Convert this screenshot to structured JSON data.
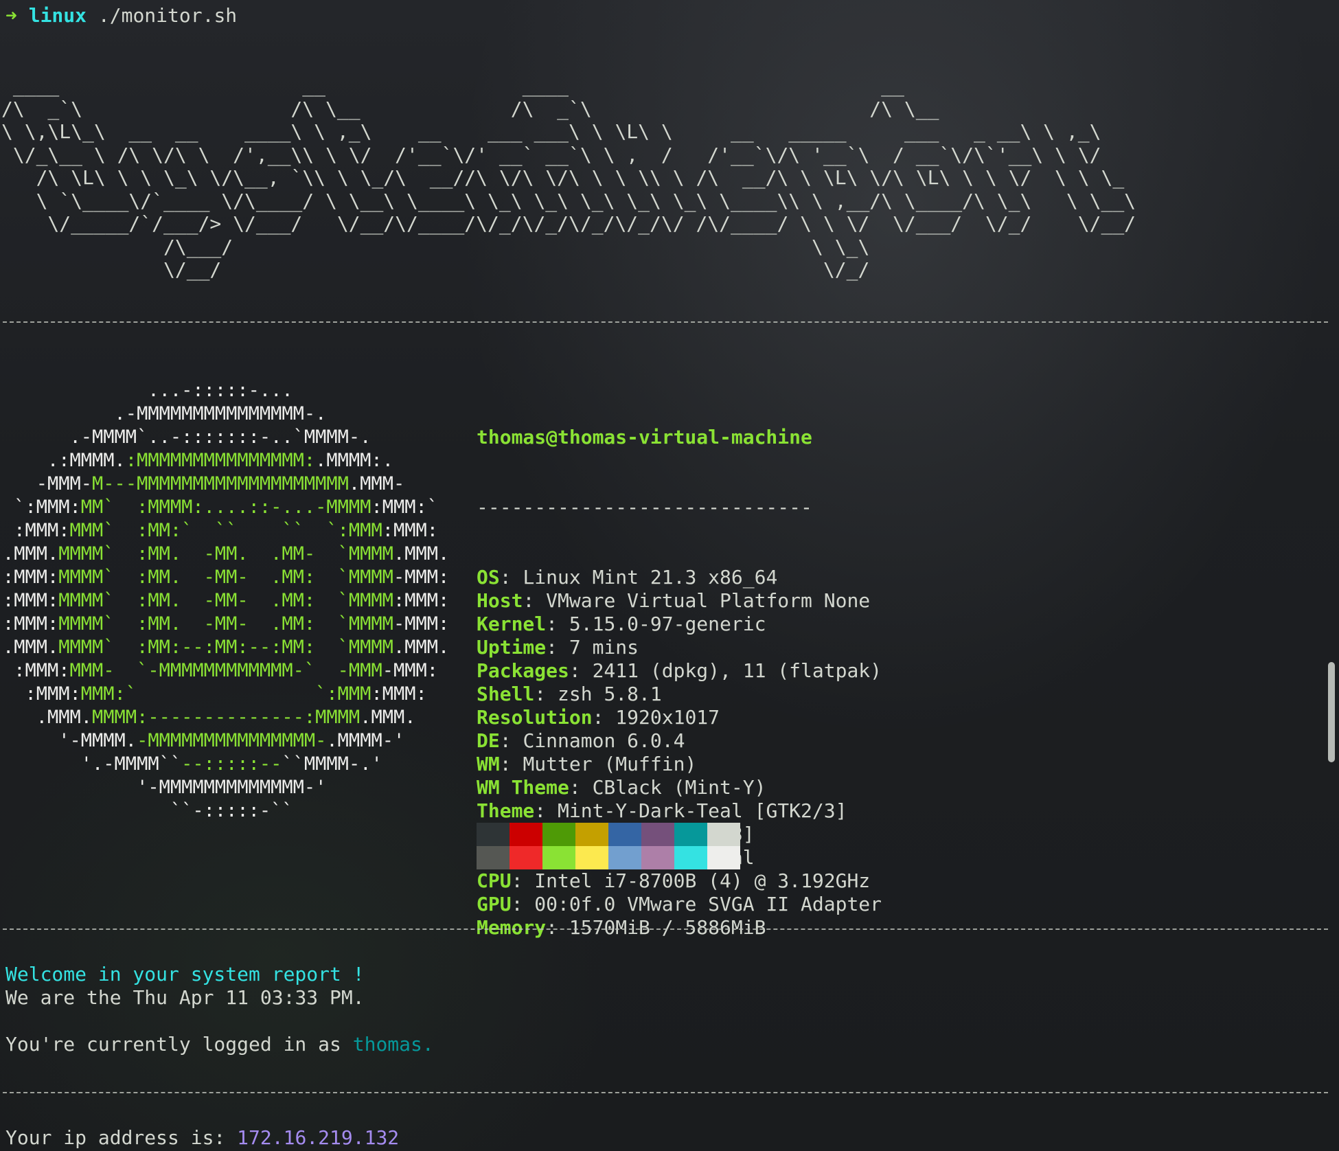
{
  "prompt": {
    "arrow": "➜",
    "dir": "linux",
    "command": "./monitor.sh"
  },
  "banner": {
    "lines": [
      " ____                     __                 ____                           __",
      "/\\  _`\\                  /\\ \\__             /\\  _`\\                        /\\ \\__",
      "\\ \\,\\L\\_\\  __  __    ____\\ \\ ,_\\    __    ___ ___\\ \\ \\L\\ \\     __   _____     ___   _ __\\ \\ ,_\\",
      " \\/_\\__ \\ /\\ \\/\\ \\  /',__\\\\ \\ \\/  /'__`\\/' __` __`\\ \\ ,  /   /'__`\\/\\ '__`\\  / __`\\/\\`'__\\ \\ \\/",
      "   /\\ \\L\\ \\ \\ \\_\\ \\/\\__, `\\\\ \\ \\_/\\  __//\\ \\/\\ \\/\\ \\ \\ \\\\ \\ /\\  __/\\ \\ \\L\\ \\/\\ \\L\\ \\ \\ \\/  \\ \\ \\_",
      "   \\ `\\____\\/`____ \\/\\____/ \\ \\__\\ \\____\\ \\_\\ \\_\\ \\_\\ \\_\\ \\_\\ \\____\\\\ \\ ,__/\\ \\____/\\ \\_\\   \\ \\__\\",
      "    \\/_____/`/___/> \\/___/   \\/__/\\/____/\\/_/\\/_/\\/_/\\/_/\\/ /\\/____/ \\ \\ \\/  \\/___/  \\/_/    \\/__/",
      "              /\\___/                                                  \\ \\_\\",
      "              \\/__/                                                    \\/_/"
    ]
  },
  "logo": {
    "lines": [
      [
        [
          "             ...-:::::-...",
          ""
        ]
      ],
      [
        [
          "          .-MMMMMMMMMMMMMMM-.",
          ""
        ]
      ],
      [
        [
          "      .-MMMM`..-:::::::-..`MMMM-.",
          ""
        ]
      ],
      [
        [
          "    .:MMMM.",
          ""
        ],
        [
          ":MMMMMMMMMMMMMMM:",
          "g"
        ],
        [
          ".MMMM:.",
          ""
        ]
      ],
      [
        [
          "   -MMM-",
          ""
        ],
        [
          "M---MMMMMMMMMMMMMMMMMMM",
          "g"
        ],
        [
          ".MMM-",
          ""
        ]
      ],
      [
        [
          " `:MMM:",
          ""
        ],
        [
          "MM`  :MMMM:....::-...-MMMM",
          "g"
        ],
        [
          ":MMM:`",
          ""
        ]
      ],
      [
        [
          " :MMM:",
          ""
        ],
        [
          "MMM`  :MM:`  ``    ``  `:MMM",
          "g"
        ],
        [
          ":MMM:",
          ""
        ]
      ],
      [
        [
          ".MMM.",
          ""
        ],
        [
          "MMMM`  :MM.  -MM.  .MM-  `MMMM",
          "g"
        ],
        [
          ".MMM.",
          ""
        ]
      ],
      [
        [
          ":MMM:",
          ""
        ],
        [
          "MMMM`  :MM.  -MM-  .MM:  `MMMM",
          "g"
        ],
        [
          "-MMM:",
          ""
        ]
      ],
      [
        [
          ":MMM:",
          ""
        ],
        [
          "MMMM`  :MM.  -MM-  .MM:  `MMMM",
          "g"
        ],
        [
          ":MMM:",
          ""
        ]
      ],
      [
        [
          ":MMM:",
          ""
        ],
        [
          "MMMM`  :MM.  -MM-  .MM:  `MMMM",
          "g"
        ],
        [
          "-MMM:",
          ""
        ]
      ],
      [
        [
          ".MMM.",
          ""
        ],
        [
          "MMMM`  :MM:--:MM:--:MM:  `MMMM",
          "g"
        ],
        [
          ".MMM.",
          ""
        ]
      ],
      [
        [
          " :MMM:",
          ""
        ],
        [
          "MMM-  `-MMMMMMMMMMMM-`  -MMM",
          "g"
        ],
        [
          "-MMM:",
          ""
        ]
      ],
      [
        [
          "  :MMM:",
          ""
        ],
        [
          "MMM:`                `:MMM",
          "g"
        ],
        [
          ":MMM:",
          ""
        ]
      ],
      [
        [
          "   .MMM.",
          ""
        ],
        [
          "MMMM:--------------:MMMM",
          "g"
        ],
        [
          ".MMM.",
          ""
        ]
      ],
      [
        [
          "     '-MMMM.",
          ""
        ],
        [
          "-MMMMMMMMMMMMMMM-",
          "g"
        ],
        [
          ".MMMM-'",
          ""
        ]
      ],
      [
        [
          "       '.-MMMM``",
          ""
        ],
        [
          "--:::::--",
          "g"
        ],
        [
          "``MMMM-.'",
          ""
        ]
      ],
      [
        [
          "            '-MMMMMMMMMMMMM-'",
          ""
        ]
      ],
      [
        [
          "               ``-:::::-``",
          ""
        ]
      ]
    ]
  },
  "system": {
    "user_host": "thomas@thomas-virtual-machine",
    "separator": "-----------------------------",
    "fields": [
      {
        "key": "OS",
        "value": "Linux Mint 21.3 x86_64"
      },
      {
        "key": "Host",
        "value": "VMware Virtual Platform None"
      },
      {
        "key": "Kernel",
        "value": "5.15.0-97-generic"
      },
      {
        "key": "Uptime",
        "value": "7 mins"
      },
      {
        "key": "Packages",
        "value": "2411 (dpkg), 11 (flatpak)"
      },
      {
        "key": "Shell",
        "value": "zsh 5.8.1"
      },
      {
        "key": "Resolution",
        "value": "1920x1017"
      },
      {
        "key": "DE",
        "value": "Cinnamon 6.0.4"
      },
      {
        "key": "WM",
        "value": "Mutter (Muffin)"
      },
      {
        "key": "WM Theme",
        "value": "CBlack (Mint-Y)"
      },
      {
        "key": "Theme",
        "value": "Mint-Y-Dark-Teal [GTK2/3]"
      },
      {
        "key": "Icons",
        "value": "ePapirus [GTK2/3]"
      },
      {
        "key": "Terminal",
        "value": "gnome-terminal"
      },
      {
        "key": "CPU",
        "value": "Intel i7-8700B (4) @ 3.192GHz"
      },
      {
        "key": "GPU",
        "value": "00:0f.0 VMware SVGA II Adapter"
      },
      {
        "key": "Memory",
        "value": "1570MiB / 5886MiB"
      }
    ],
    "palette": {
      "normal": [
        "#2e3436",
        "#cc0000",
        "#4e9a06",
        "#c4a000",
        "#3465a4",
        "#75507b",
        "#06989a",
        "#d3d7cf"
      ],
      "bright": [
        "#555753",
        "#ef2929",
        "#8ae234",
        "#fce94f",
        "#729fcf",
        "#ad7fa8",
        "#34e2e2",
        "#eeeeec"
      ]
    }
  },
  "report": {
    "welcome": "Welcome in your system report !",
    "date_prefix": "We are the ",
    "date_value": "Thu Apr 11 03:33 PM.",
    "login_prefix": "You're currently logged in as ",
    "login_user": "thomas.",
    "ip_prefix": "Your ip address is: ",
    "ip_value": "172.16.219.132"
  },
  "scrollbar": {
    "position": 0.63
  }
}
